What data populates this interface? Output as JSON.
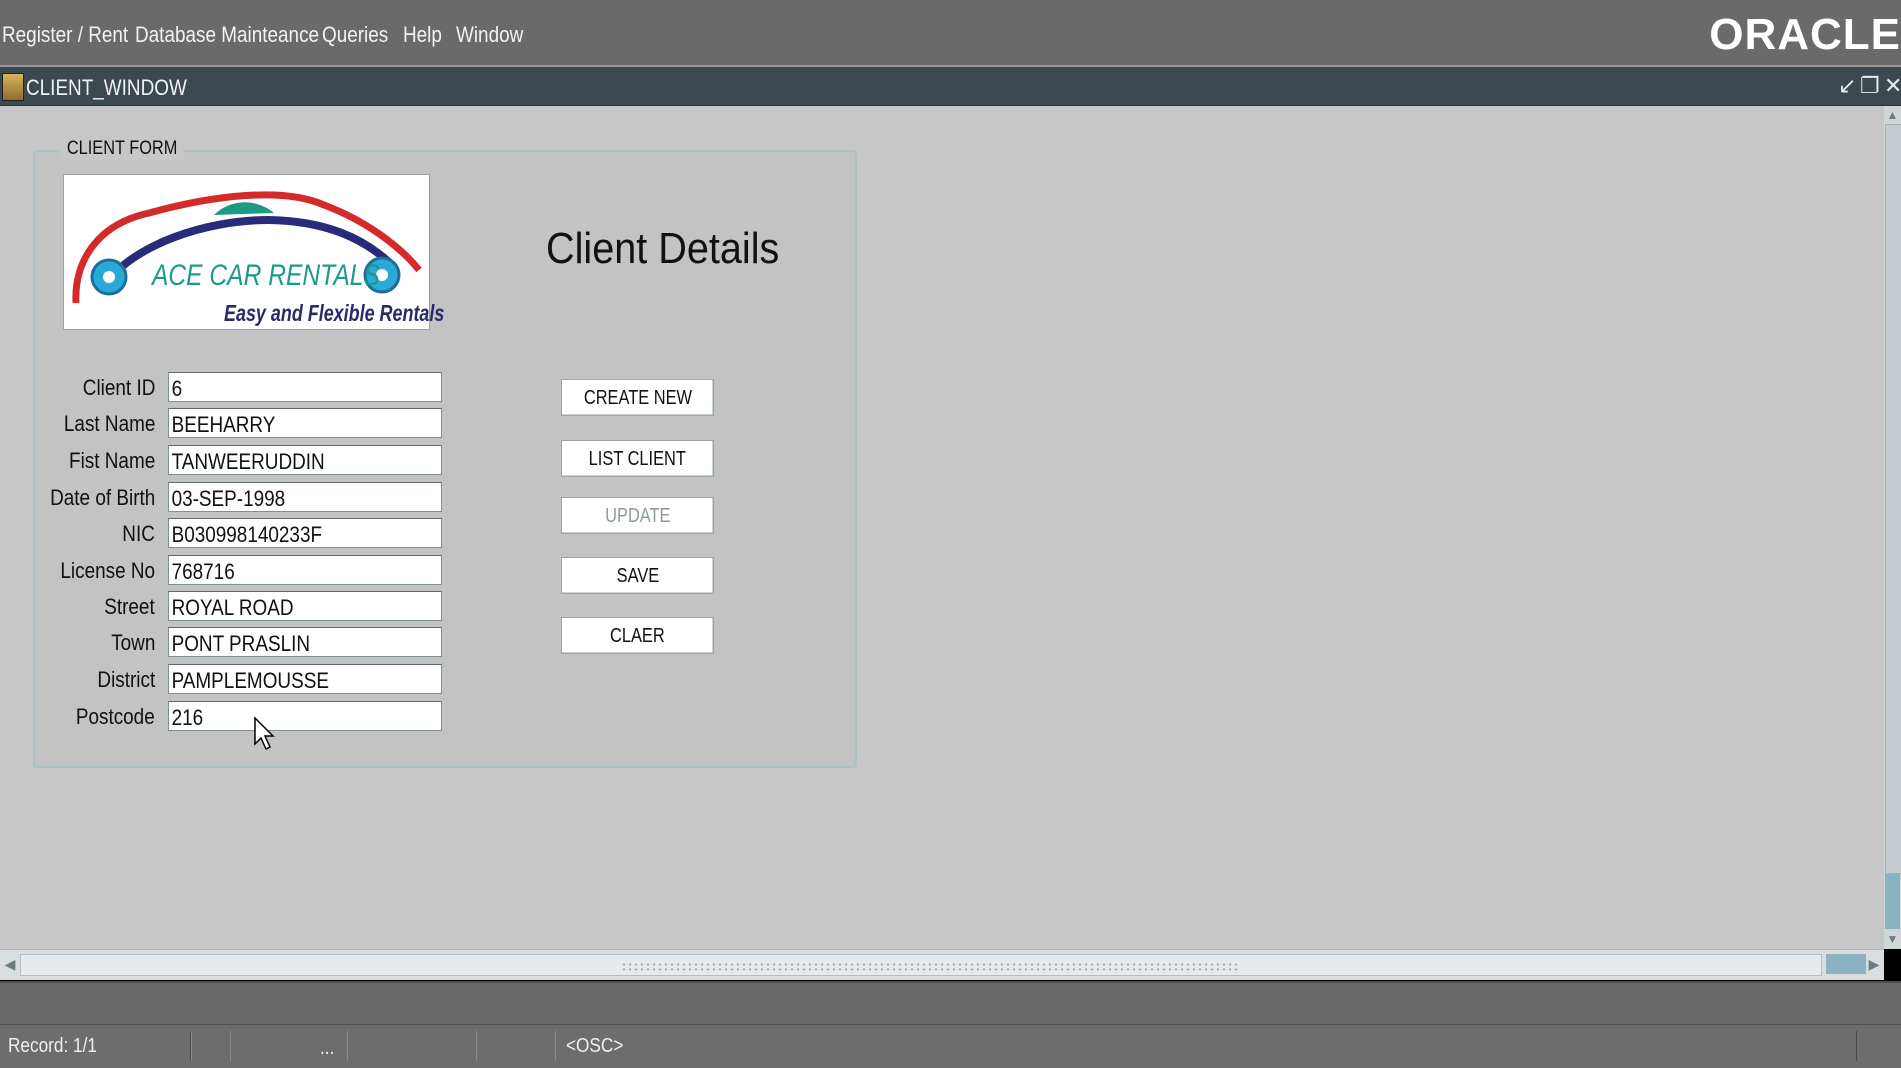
{
  "menu": {
    "items": [
      "Register / Rent",
      "Database Mainteance",
      "Queries",
      "Help",
      "Window"
    ],
    "brand": "ORACLE"
  },
  "window": {
    "title": "CLIENT_WINDOW",
    "controls": [
      "minimize",
      "restore",
      "close"
    ]
  },
  "form": {
    "frame_title": "CLIENT FORM",
    "logo": {
      "name": "ACE CAR RENTALS",
      "tagline": "Easy and Flexible Rentals"
    },
    "heading": "Client Details",
    "fields": [
      {
        "label": "Client ID",
        "value": "6"
      },
      {
        "label": "Last Name",
        "value": "BEEHARRY"
      },
      {
        "label": "Fist Name",
        "value": "TANWEERUDDIN"
      },
      {
        "label": "Date of Birth",
        "value": "03-SEP-1998"
      },
      {
        "label": "NIC",
        "value": "B030998140233F"
      },
      {
        "label": "License No",
        "value": "768716"
      },
      {
        "label": "Street",
        "value": "ROYAL ROAD"
      },
      {
        "label": "Town",
        "value": "PONT PRASLIN"
      },
      {
        "label": "District",
        "value": "PAMPLEMOUSSE"
      },
      {
        "label": "Postcode",
        "value": "216"
      }
    ],
    "buttons": [
      {
        "label": "CREATE NEW",
        "enabled": true
      },
      {
        "label": "LIST CLIENT",
        "enabled": true
      },
      {
        "label": "UPDATE",
        "enabled": false
      },
      {
        "label": "SAVE",
        "enabled": true
      },
      {
        "label": "CLAER",
        "enabled": true
      }
    ]
  },
  "status": {
    "record": "Record: 1/1",
    "ellipsis": "...",
    "mode": "<OSC>"
  },
  "colors": {
    "menubar": "#6a6a6a",
    "titlebar": "#3c4a50",
    "canvas": "#c7c7c7",
    "frame_border": "#a8c4c8",
    "logo_teal": "#1d9a87",
    "logo_red": "#d42a2a",
    "logo_navy": "#2a2a7a"
  }
}
